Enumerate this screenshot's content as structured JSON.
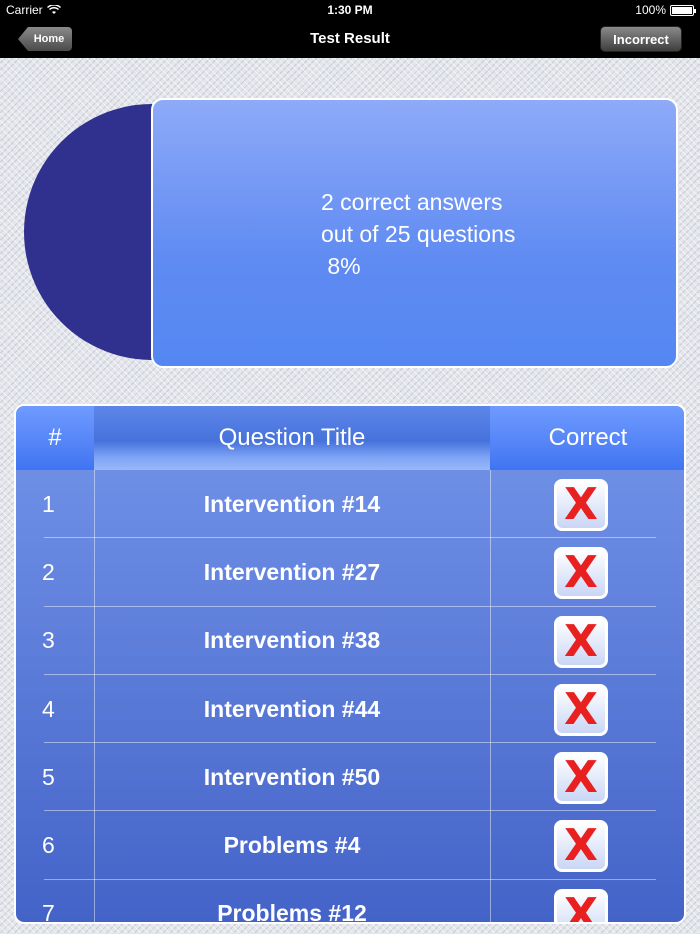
{
  "status_bar": {
    "carrier": "Carrier",
    "time": "1:30 PM",
    "battery": "100%"
  },
  "nav": {
    "title": "Test Result",
    "home_label": "Home",
    "incorrect_label": "Incorrect"
  },
  "summary": {
    "text": "2 correct answers\nout of 25 questions\n 8%",
    "correct": 2,
    "total": 25,
    "percent": 8
  },
  "chart_data": {
    "type": "pie",
    "values": [
      8,
      92
    ],
    "colors": [
      "#00ffee",
      "#30318f"
    ]
  },
  "table": {
    "headers": {
      "num": "#",
      "title": "Question Title",
      "correct": "Correct"
    },
    "mark_glyph": "X",
    "rows": [
      {
        "num": "1",
        "title": "Intervention #14"
      },
      {
        "num": "2",
        "title": "Intervention #27"
      },
      {
        "num": "3",
        "title": "Intervention #38"
      },
      {
        "num": "4",
        "title": "Intervention #44"
      },
      {
        "num": "5",
        "title": "Intervention #50"
      },
      {
        "num": "6",
        "title": "Problems #4"
      },
      {
        "num": "7",
        "title": "Problems #12"
      }
    ]
  }
}
